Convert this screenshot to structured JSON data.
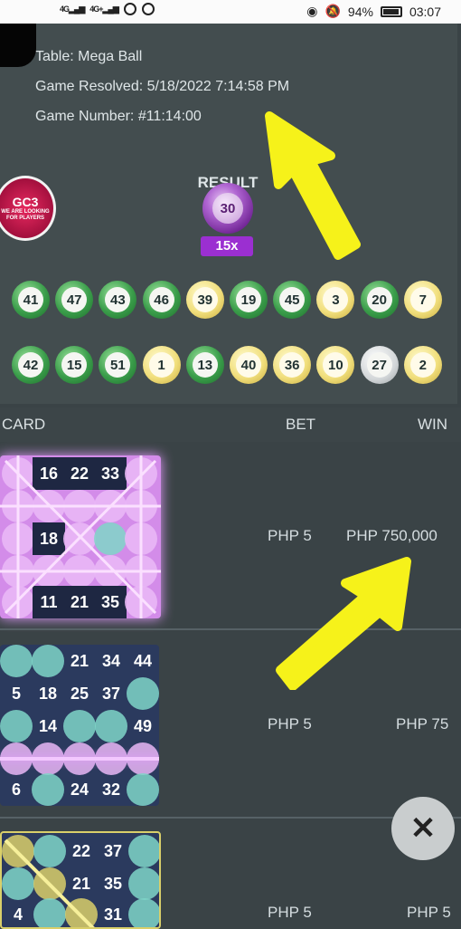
{
  "status_bar": {
    "network_left": "4G",
    "network_right": "4G+",
    "battery": "94%",
    "time": "03:07"
  },
  "game_info": {
    "table": "Table: Mega Ball",
    "resolved": "Game Resolved: 5/18/2022 7:14:58 PM",
    "number": "Game Number: #11:14:00"
  },
  "result": {
    "label": "RESULT",
    "mega_ball": "30",
    "multiplier": "15x"
  },
  "gc3_badge": {
    "title": "GC3",
    "text": "WE ARE LOOKING FOR PLAYERS"
  },
  "drawn_balls": {
    "row1": [
      {
        "n": "41",
        "c": "g"
      },
      {
        "n": "47",
        "c": "g"
      },
      {
        "n": "43",
        "c": "g"
      },
      {
        "n": "46",
        "c": "g"
      },
      {
        "n": "39",
        "c": "y"
      },
      {
        "n": "19",
        "c": "g"
      },
      {
        "n": "45",
        "c": "g"
      },
      {
        "n": "3",
        "c": "y"
      },
      {
        "n": "20",
        "c": "g"
      },
      {
        "n": "7",
        "c": "y"
      }
    ],
    "row2": [
      {
        "n": "42",
        "c": "g"
      },
      {
        "n": "15",
        "c": "g"
      },
      {
        "n": "51",
        "c": "g"
      },
      {
        "n": "1",
        "c": "y"
      },
      {
        "n": "13",
        "c": "g"
      },
      {
        "n": "40",
        "c": "y"
      },
      {
        "n": "36",
        "c": "y"
      },
      {
        "n": "10",
        "c": "y"
      },
      {
        "n": "27",
        "c": "w"
      },
      {
        "n": "2",
        "c": "y"
      }
    ]
  },
  "table_header": {
    "card": "CARD",
    "bet": "BET",
    "win": "WIN"
  },
  "rows": [
    {
      "bet": "PHP 5",
      "win": "PHP 750,000"
    },
    {
      "bet": "PHP 5",
      "win": "PHP 75"
    },
    {
      "bet": "PHP 5",
      "win": "PHP 5"
    }
  ],
  "card1_numbers": [
    "16",
    "22",
    "33",
    "18",
    "11",
    "21",
    "35"
  ],
  "card2_numbers": [
    "21",
    "34",
    "44",
    "5",
    "18",
    "25",
    "37",
    "14",
    "49",
    "6",
    "24",
    "32"
  ],
  "card3_numbers": [
    "22",
    "37",
    "21",
    "35",
    "4",
    "31"
  ],
  "close_symbol": "✕",
  "colors": {
    "arrow": "#f6f21a",
    "mega": "#9b2fd1",
    "highlight": "#e59cff"
  }
}
